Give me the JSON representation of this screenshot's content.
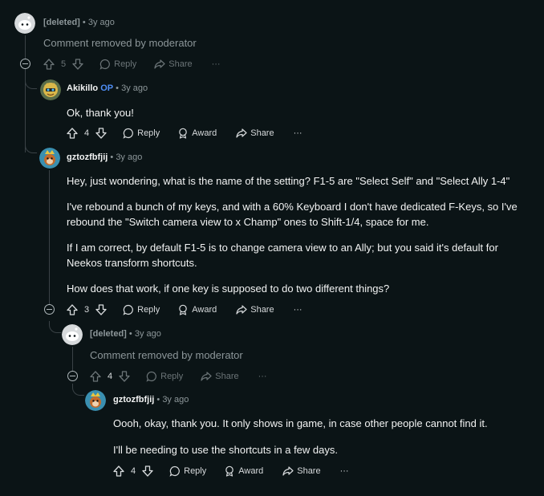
{
  "comments": [
    {
      "author": "[deleted]",
      "op_badge": "",
      "time": "3y ago",
      "paragraphs": [
        "Comment removed by moderator"
      ],
      "votes": "5",
      "actions": {
        "reply": "Reply",
        "award": "",
        "share": "Share",
        "more": "···"
      }
    },
    {
      "author": "Akikillo",
      "op_badge": "OP",
      "time": "3y ago",
      "paragraphs": [
        "Ok, thank you!"
      ],
      "votes": "4",
      "actions": {
        "reply": "Reply",
        "award": "Award",
        "share": "Share",
        "more": "···"
      }
    },
    {
      "author": "gztozfbfjij",
      "op_badge": "",
      "time": "3y ago",
      "paragraphs": [
        "Hey, just wondering, what is the name of the setting? F1-5 are \"Select Self\" and \"Select Ally 1-4\"",
        "I've rebound a bunch of my keys, and with a 60% Keyboard I don't have dedicated F-Keys, so I've rebound the \"Switch camera view to x Champ\" ones to Shift-1/4, space for me.",
        "If I am correct, by default F1-5 is to change camera view to an Ally; but you said it's default for Neekos transform shortcuts.",
        "How does that work, if one key is supposed to do two different things?"
      ],
      "votes": "3",
      "actions": {
        "reply": "Reply",
        "award": "Award",
        "share": "Share",
        "more": "···"
      }
    },
    {
      "author": "[deleted]",
      "op_badge": "",
      "time": "3y ago",
      "paragraphs": [
        "Comment removed by moderator"
      ],
      "votes": "4",
      "actions": {
        "reply": "Reply",
        "award": "",
        "share": "Share",
        "more": "···"
      }
    },
    {
      "author": "gztozfbfjij",
      "op_badge": "",
      "time": "3y ago",
      "paragraphs": [
        "Oooh, okay, thank you. It only shows in game, in case other people cannot find it.",
        "I'll be needing to use the shortcuts in a few days."
      ],
      "votes": "4",
      "actions": {
        "reply": "Reply",
        "award": "Award",
        "share": "Share",
        "more": "···"
      }
    }
  ],
  "separator": "•",
  "colors": {
    "background": "#0b1416",
    "op_badge": "#4f8ff7",
    "text": "#f2f3f3",
    "muted": "#8c9699"
  }
}
